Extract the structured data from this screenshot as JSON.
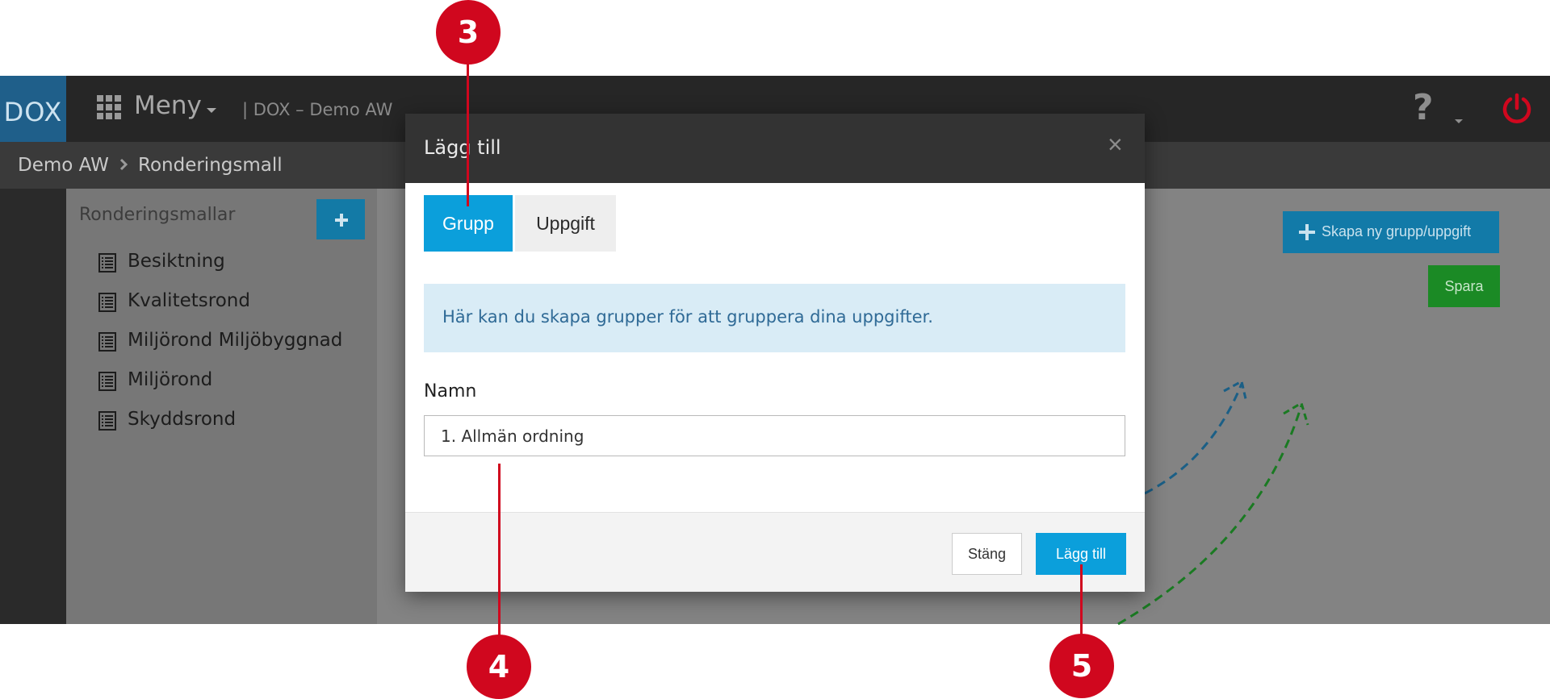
{
  "app": {
    "logo_text": "DOX",
    "menu_label": "Meny",
    "app_title": "| DOX – Demo AW",
    "help_glyph": "?"
  },
  "breadcrumb": {
    "root": "Demo AW",
    "current": "Ronderingsmall"
  },
  "panel": {
    "title": "Ronderingsmallar",
    "items": [
      {
        "label": "Besiktning"
      },
      {
        "label": "Kvalitetsrond"
      },
      {
        "label": "Miljörond Miljöbyggnad"
      },
      {
        "label": "Miljörond"
      },
      {
        "label": "Skyddsrond"
      }
    ]
  },
  "main": {
    "create_label": "Skapa ny grupp/uppgift",
    "save_label": "Spara"
  },
  "modal": {
    "title": "Lägg till",
    "close_glyph": "×",
    "tabs": [
      {
        "label": "Grupp",
        "active": true
      },
      {
        "label": "Uppgift",
        "active": false
      }
    ],
    "info_text": "Här kan du skapa grupper för att gruppera dina uppgifter.",
    "name_label": "Namn",
    "name_value": "1. Allmän ordning",
    "close_button": "Stäng",
    "add_button": "Lägg till"
  },
  "callouts": [
    {
      "number": "3"
    },
    {
      "number": "4"
    },
    {
      "number": "5"
    }
  ],
  "colors": {
    "accent_blue": "#0b9fdb",
    "callout_red": "#d0071e",
    "save_green": "#1b8a25",
    "topbar": "#262626"
  }
}
